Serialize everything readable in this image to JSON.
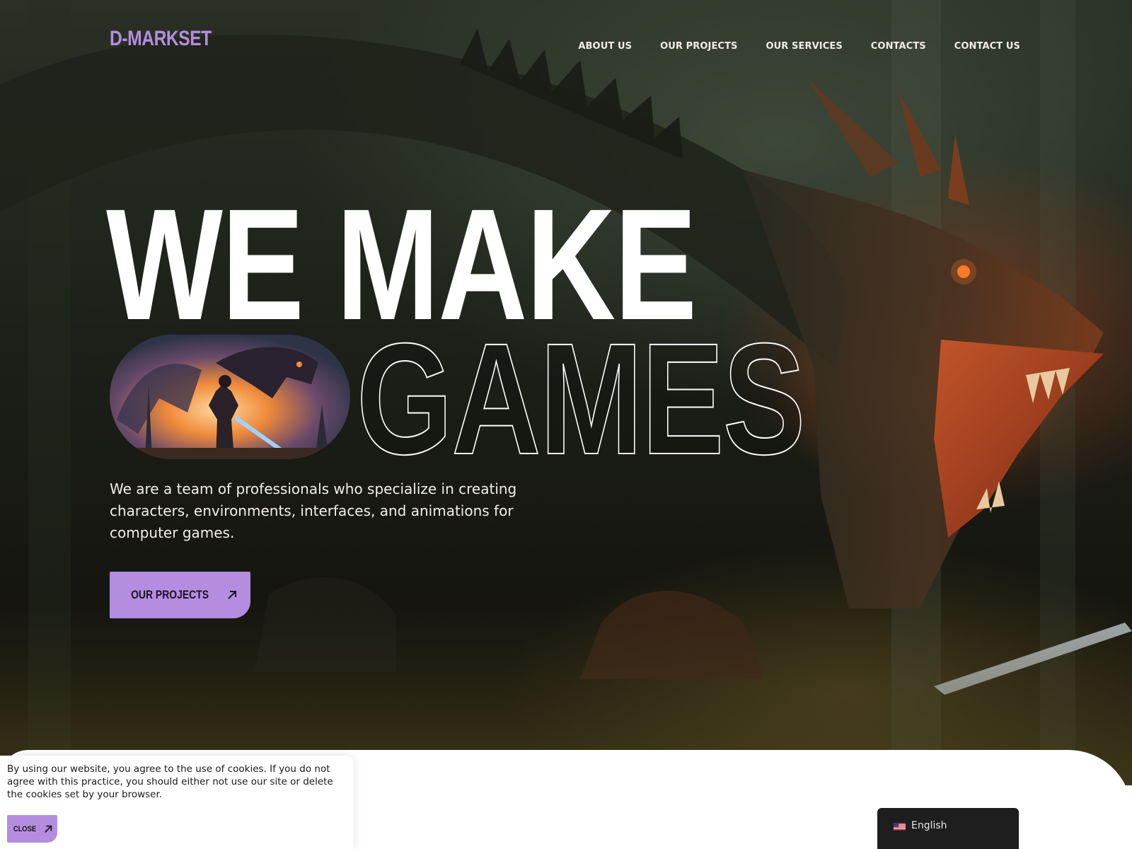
{
  "brand": {
    "logo_text": "D-MARKSET",
    "accent_color": "#b48de0"
  },
  "nav": {
    "items": [
      {
        "label": "ABOUT US"
      },
      {
        "label": "OUR PROJECTS"
      },
      {
        "label": "OUR SERVICES"
      },
      {
        "label": "CONTACTS"
      },
      {
        "label": "CONTACT US"
      }
    ]
  },
  "hero": {
    "headline_line1": "WE MAKE",
    "headline_line2": "GAMES",
    "tagline": "We are a team of professionals who specialize in creating characters, environments, interfaces, and animations for computer games.",
    "cta_label": "OUR PROJECTS",
    "cta_icon": "arrow-up-right-icon"
  },
  "cookie_banner": {
    "text": "By using our website, you agree to the use of cookies. If you do not agree with this practice, you should either not use our site or delete the cookies set by your browser.",
    "close_label": "CLOSE",
    "close_icon": "arrow-up-right-icon"
  },
  "language_switcher": {
    "selected": "English",
    "flag_icon": "us-flag-icon"
  }
}
